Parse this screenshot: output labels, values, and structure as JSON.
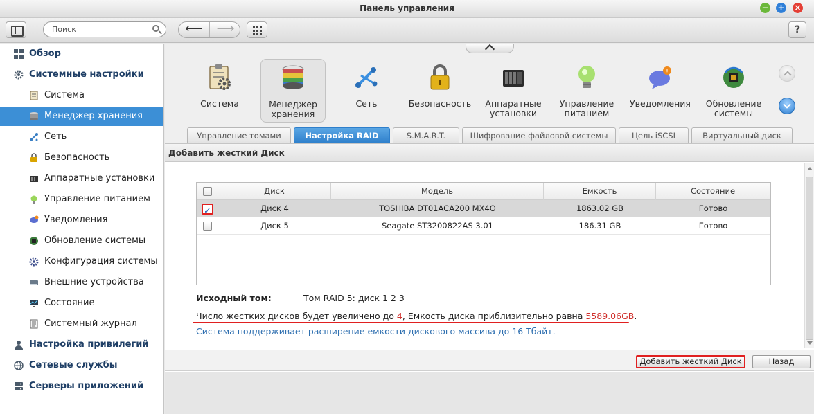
{
  "window": {
    "title": "Панель управления"
  },
  "toolbar": {
    "search_placeholder": "Поиск",
    "help_label": "?"
  },
  "sidebar": {
    "items": [
      {
        "label": "Обзор",
        "level": "top"
      },
      {
        "label": "Системные настройки",
        "level": "top"
      },
      {
        "label": "Система",
        "level": "sub"
      },
      {
        "label": "Менеджер хранения",
        "level": "sub",
        "active": true
      },
      {
        "label": "Сеть",
        "level": "sub"
      },
      {
        "label": "Безопасность",
        "level": "sub"
      },
      {
        "label": "Аппаратные установки",
        "level": "sub"
      },
      {
        "label": "Управление питанием",
        "level": "sub"
      },
      {
        "label": "Уведомления",
        "level": "sub"
      },
      {
        "label": "Обновление системы",
        "level": "sub"
      },
      {
        "label": "Конфигурация системы",
        "level": "sub"
      },
      {
        "label": "Внешние устройства",
        "level": "sub"
      },
      {
        "label": "Состояние",
        "level": "sub"
      },
      {
        "label": "Системный журнал",
        "level": "sub"
      },
      {
        "label": "Настройка привилегий",
        "level": "top"
      },
      {
        "label": "Сетевые службы",
        "level": "top"
      },
      {
        "label": "Серверы приложений",
        "level": "top"
      }
    ]
  },
  "apps": [
    {
      "line1": "Система",
      "line2": "",
      "icon": "clipboard-gear-icon"
    },
    {
      "line1": "Менеджер",
      "line2": "хранения",
      "icon": "storage-disks-icon",
      "selected": true
    },
    {
      "line1": "Сеть",
      "line2": "",
      "icon": "network-icon"
    },
    {
      "line1": "Безопасность",
      "line2": "",
      "icon": "padlock-icon"
    },
    {
      "line1": "Аппаратные",
      "line2": "установки",
      "icon": "hardware-icon"
    },
    {
      "line1": "Управление",
      "line2": "питанием",
      "icon": "lightbulb-icon"
    },
    {
      "line1": "Уведомления",
      "line2": "",
      "icon": "notification-bubble-icon"
    },
    {
      "line1": "Обновление",
      "line2": "системы",
      "icon": "chip-update-icon"
    }
  ],
  "tabs": [
    {
      "label": "Управление томами"
    },
    {
      "label": "Настройка RAID",
      "active": true
    },
    {
      "label": "S.M.A.R.T."
    },
    {
      "label": "Шифрование файловой системы"
    },
    {
      "label": "Цель iSCSI"
    },
    {
      "label": "Виртуальный диск"
    }
  ],
  "section": {
    "title": "Добавить жесткий Диск"
  },
  "table": {
    "columns": [
      "Диск",
      "Модель",
      "Емкость",
      "Состояние"
    ],
    "rows": [
      {
        "checked": true,
        "disk": "Диск 4",
        "model": "TOSHIBA DT01ACA200 MX4O",
        "capacity": "1863.02 GB",
        "status": "Готово"
      },
      {
        "checked": false,
        "disk": "Диск 5",
        "model": "Seagate ST3200822AS 3.01",
        "capacity": "186.31 GB",
        "status": "Готово"
      }
    ]
  },
  "info": {
    "source_label": "Исходный том:",
    "source_value": "Том RAID 5: диск 1 2 3",
    "msg_part1": "Число жестких дисков будет увеличено до ",
    "msg_count": "4",
    "msg_part2": ", Емкость диска приблизительно равна ",
    "msg_capacity": "5589.06GB",
    "msg_part3": ".",
    "support_msg": "Система поддерживает расширение емкости дискового массива до 16 Тбайт."
  },
  "buttons": {
    "add": "Добавить жесткий Диск",
    "back": "Назад"
  },
  "colors": {
    "accent": "#3c8fd6",
    "highlight_red": "#e02020"
  }
}
